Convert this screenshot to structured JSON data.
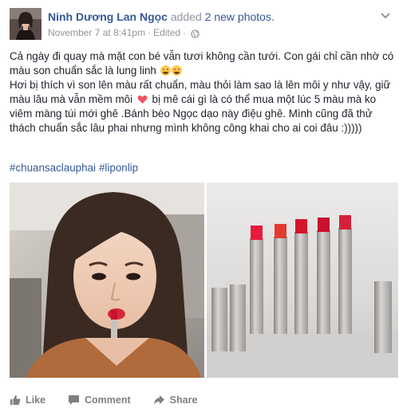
{
  "post": {
    "author": "Ninh Dương Lan Ngọc",
    "action_prefix": "added",
    "action_count": "2 new photos.",
    "timestamp": "November 7 at 8:41pm",
    "separator_1": "·",
    "edited": "Edited",
    "separator_2": "·",
    "privacy_icon": "globe-icon",
    "text_line_1": "Cả ngày đi quay mà mặt con bé vẫn tươi không cần tưới. Con gái chỉ cần nhờ có màu son chuẩn sắc là lung linh",
    "text_line_2a": "Hơi bị thích vì son lên màu rất chuẩn, màu thỏi làm sao là lên môi y như vậy, giữ màu lâu mà vẫn mềm môi",
    "text_line_2b": "bị mê cái gì là có thể mua một lúc 5 màu mà ko viêm màng túi mới ghê .Bánh bèo Ngọc dạo này điệu ghê. Mình cũng đã thử thách chuẩn sắc lâu phai nhưng mình không công khai cho ai coi đâu :)))))",
    "hashtags": [
      "#chuansaclauphai",
      "#liponlip"
    ]
  },
  "photos": [
    {
      "subject": "selfie-with-lipstick"
    },
    {
      "subject": "five-red-lipsticks"
    }
  ],
  "actions": {
    "like": "Like",
    "comment": "Comment",
    "share": "Share"
  },
  "colors": {
    "link": "#365899",
    "meta": "#90949c",
    "text": "#1d2129",
    "action": "#7f7f7f"
  }
}
